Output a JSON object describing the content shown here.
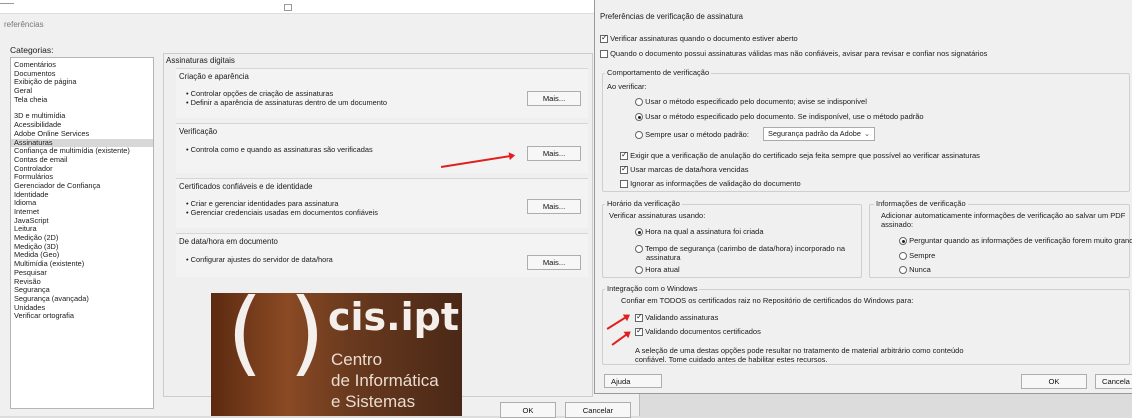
{
  "back": {
    "window_title": "referências",
    "categories_label": "Categorias:",
    "categories_group1": [
      "Comentários",
      "Documentos",
      "Exibição de página",
      "Geral",
      "Tela cheia"
    ],
    "categories_group2": [
      "3D e multimídia",
      "Acessibilidade",
      "Adobe Online Services",
      "Assinaturas",
      "Confiança de multimídia (existente)",
      "Contas de email",
      "Controlador",
      "Formulários",
      "Gerenciador de Confiança",
      "Identidade",
      "Idioma",
      "Internet",
      "JavaScript",
      "Leitura",
      "Medição (2D)",
      "Medição (3D)",
      "Medida (Geo)",
      "Multimídia (existente)",
      "Pesquisar",
      "Revisão",
      "Segurança",
      "Segurança (avançada)",
      "Unidades",
      "Verificar ortografia"
    ],
    "selected_category": "Assinaturas",
    "panel_title": "Assinaturas digitais",
    "sections": [
      {
        "title": "Criação e aparência",
        "bullets": [
          "• Controlar opções de criação de assinaturas",
          "• Definir a aparência de assinaturas dentro de um documento"
        ],
        "button": "Mais..."
      },
      {
        "title": "Verificação",
        "bullets": [
          "• Controla como e quando as assinaturas são verificadas"
        ],
        "button": "Mais..."
      },
      {
        "title": "Certificados confiáveis e de identidade",
        "bullets": [
          "• Criar e gerenciar identidades para assinatura",
          "• Gerenciar credenciais usadas em documentos confiáveis"
        ],
        "button": "Mais..."
      },
      {
        "title": "De data/hora em documento",
        "bullets": [
          "• Configurar ajustes do servidor de data/hora"
        ],
        "button": "Mais..."
      }
    ],
    "ok": "OK",
    "cancel": "Cancelar",
    "logo": {
      "brand": "cis.ipt",
      "line1": "Centro",
      "line2": "de Informática",
      "line3": "e Sistemas"
    }
  },
  "dialog": {
    "title": "Preferências de verificação de assinatura",
    "check_open": {
      "label": "Verificar assinaturas quando o documento estiver aberto",
      "checked": true
    },
    "check_untrusted": {
      "label": "Quando o documento possui assinaturas válidas mas não confiáveis, avisar para revisar e confiar nos signatários",
      "checked": false
    },
    "behavior": {
      "group_label": "Comportamento de verificação",
      "when_label": "Ao verificar:",
      "radio1": "Usar o método especificado pelo documento; avise se indisponível",
      "radio2": "Usar o método especificado pelo documento. Se indisponível, use o método padrão",
      "radio3": "Sempre usar o método padrão:",
      "selected_radio": 2,
      "default_method": "Segurança padrão da Adobe",
      "chk_revocation": {
        "label": "Exigir que a verificação de anulação do certificado seja feita sempre que possível ao verificar assinaturas",
        "checked": true
      },
      "chk_expired": {
        "label": "Usar marcas de data/hora vencidas",
        "checked": true
      },
      "chk_ignore": {
        "label": "Ignorar as informações de validação do documento",
        "checked": false
      }
    },
    "time": {
      "group_label": "Horário da verificação",
      "verify_label": "Verificar assinaturas usando:",
      "radio1": "Hora na qual a assinatura foi criada",
      "radio2_line1": "Tempo de segurança (carimbo de data/hora) incorporado na",
      "radio2_line2": "assinatura",
      "radio3": "Hora atual",
      "selected_radio": 1
    },
    "info": {
      "group_label": "Informações de verificação",
      "desc_line1": "Adicionar automaticamente informações de verificação ao salvar um PDF",
      "desc_line2": "assinado:",
      "radio1": "Perguntar quando as informações de verificação forem muito grandes",
      "radio2": "Sempre",
      "radio3": "Nunca",
      "selected_radio": 1
    },
    "windows": {
      "group_label": "Integração com o Windows",
      "trust_label": "Confiar em TODOS os certificados raiz no Repositório de certificados do Windows para:",
      "chk_sign": {
        "label": "Validando assinaturas",
        "checked": true
      },
      "chk_cert": {
        "label": "Validando documentos certificados",
        "checked": true
      },
      "note_line1": "A seleção de uma destas opções pode resultar no tratamento de material arbitrário como conteúdo",
      "note_line2": "confiável. Tome cuidado antes de habilitar estes recursos."
    },
    "help": "Ajuda",
    "ok": "OK",
    "cancel": "Cancela"
  },
  "colors": {
    "annotation_arrow": "#e02020"
  }
}
